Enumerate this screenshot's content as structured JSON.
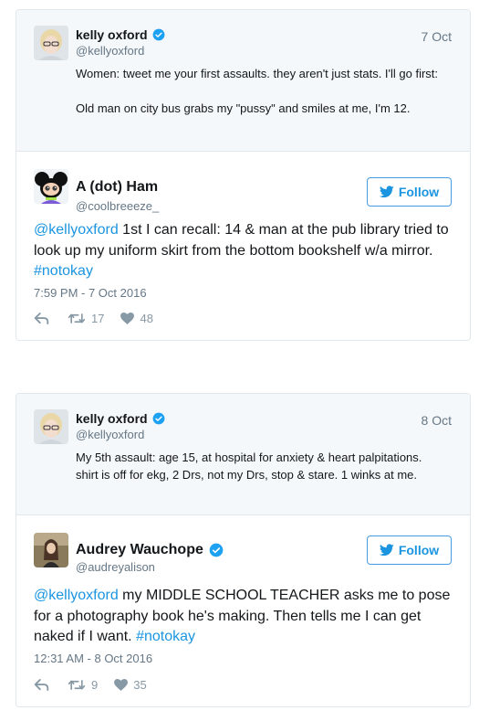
{
  "tweets": [
    {
      "quoted": {
        "name": "kelly oxford",
        "handle": "@kellyoxford",
        "date": "7 Oct",
        "text_lines": [
          "Women: tweet me your first assaults. they aren't just stats. I'll go first:",
          "Old man on city bus grabs my \"pussy\" and smiles at me, I'm 12."
        ]
      },
      "author": {
        "name": "A (dot) Ham",
        "handle": "@coolbreeeze_",
        "verified": false
      },
      "follow_label": "Follow",
      "mention": "@kellyoxford",
      "body": " 1st I can recall: 14 & man at the pub library tried to look up my uniform skirt from the bottom bookshelf w/a mirror. ",
      "hashtag": "#notokay",
      "timestamp": "7:59 PM - 7 Oct 2016",
      "retweets": "17",
      "likes": "48"
    },
    {
      "quoted": {
        "name": "kelly oxford",
        "handle": "@kellyoxford",
        "date": "8 Oct",
        "text_lines": [
          "My 5th assault: age 15, at hospital for anxiety & heart palpitations. shirt is off for ekg, 2 Drs, not my Drs, stop & stare. 1 winks at me."
        ]
      },
      "author": {
        "name": "Audrey Wauchope",
        "handle": "@audreyalison",
        "verified": true
      },
      "follow_label": "Follow",
      "mention": "@kellyoxford",
      "body": " my MIDDLE SCHOOL TEACHER asks me to pose for a photography book he's making. Then tells me I can get naked if I want. ",
      "hashtag": "#notokay",
      "timestamp": "12:31 AM - 8 Oct 2016",
      "retweets": "9",
      "likes": "35"
    }
  ],
  "colors": {
    "link": "#1b95e0",
    "muted": "#657786",
    "border": "#e1e8ed",
    "quoted_bg": "#f5f8fa"
  },
  "icons": [
    "verified-badge-icon",
    "twitter-bird-icon",
    "reply-icon",
    "retweet-icon",
    "like-heart-icon"
  ]
}
